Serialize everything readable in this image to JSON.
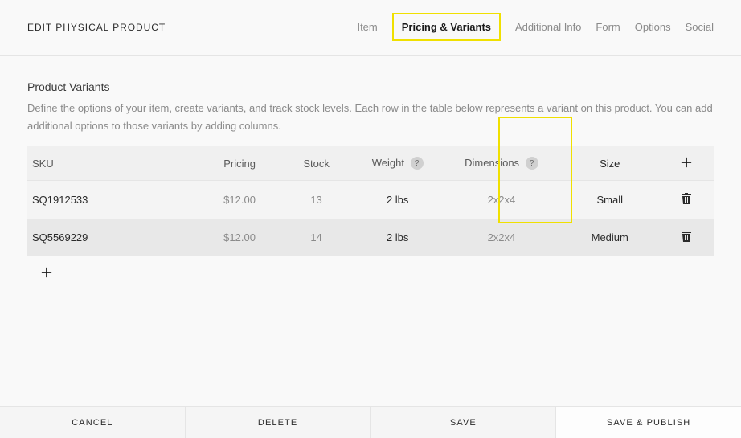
{
  "header": {
    "title": "EDIT PHYSICAL PRODUCT",
    "tabs": {
      "item": "Item",
      "pricing": "Pricing & Variants",
      "additional": "Additional Info",
      "form": "Form",
      "options": "Options",
      "social": "Social"
    }
  },
  "section": {
    "title": "Product Variants",
    "desc": "Define the options of your item, create variants, and track stock levels. Each row in the table below represents a variant on this product. You can add additional options to those variants by adding columns."
  },
  "columns": {
    "sku": "SKU",
    "pricing": "Pricing",
    "stock": "Stock",
    "weight": "Weight",
    "dimensions": "Dimensions",
    "size": "Size"
  },
  "help_glyph": "?",
  "rows": [
    {
      "sku": "SQ1912533",
      "pricing": "$12.00",
      "stock": "13",
      "weight": "2 lbs",
      "dimensions": "2x2x4",
      "size": "Small"
    },
    {
      "sku": "SQ5569229",
      "pricing": "$12.00",
      "stock": "14",
      "weight": "2 lbs",
      "dimensions": "2x2x4",
      "size": "Medium"
    }
  ],
  "footer": {
    "cancel": "CANCEL",
    "delete": "DELETE",
    "save": "SAVE",
    "save_publish": "SAVE & PUBLISH"
  }
}
